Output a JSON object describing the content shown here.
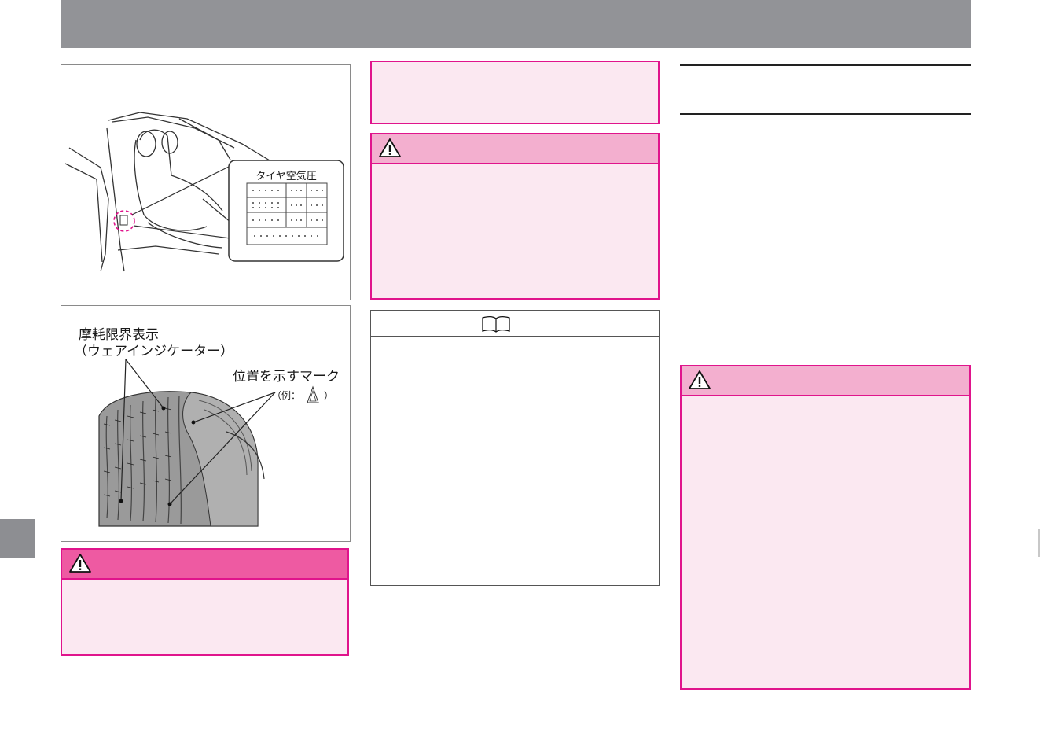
{
  "colors": {
    "header_band": "#929397",
    "accent_pink": "#e0148c",
    "caution_header": "#f3afcf",
    "warning_header": "#ee5aa2",
    "box_fill": "#fbe8f1"
  },
  "figure_door": {
    "label_title": "タイヤ空気圧"
  },
  "figure_tire": {
    "label_wear_line1": "摩耗限界表示",
    "label_wear_line2": "（ウェアインジケーター）",
    "label_position": "位置を示すマーク",
    "label_example_prefix": "（例：",
    "label_example_suffix": "）"
  },
  "icons": {
    "warning": "warning-triangle-icon",
    "note": "open-book-icon"
  }
}
